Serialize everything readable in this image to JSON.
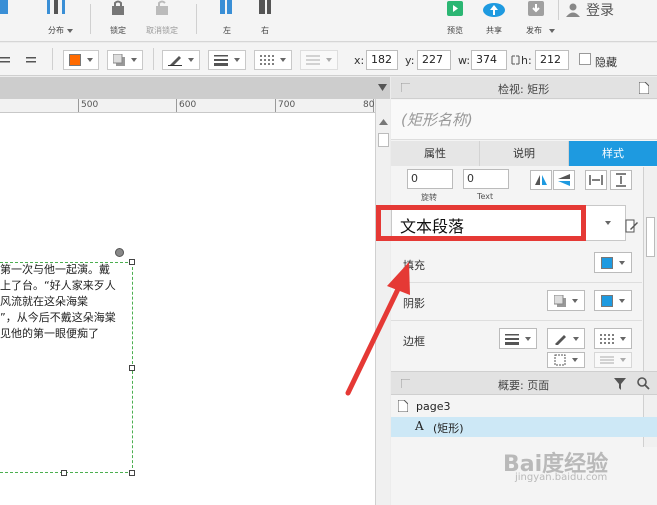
{
  "toolbar": {
    "items": [
      {
        "label": "分布"
      },
      {
        "label": "锁定"
      },
      {
        "label": "取消锁定"
      },
      {
        "label": "左"
      },
      {
        "label": "右"
      },
      {
        "label": "预览"
      },
      {
        "label": "共享"
      },
      {
        "label": "发布"
      }
    ],
    "login_label": "登录"
  },
  "format_bar": {
    "fill_color": "#ff6a00",
    "x_label": "x:",
    "x_value": "182",
    "y_label": "y:",
    "y_value": "227",
    "w_label": "w:",
    "w_value": "374",
    "h_label": "h:",
    "h_value": "212",
    "hidden_label": "隐藏"
  },
  "ruler": {
    "ticks": [
      "500",
      "600",
      "700",
      "80"
    ]
  },
  "canvas": {
    "paragraph_lines": [
      "第一次与他一起演。戴",
      "上了台。“好人家来歹人",
      "风流就在这朵海棠",
      "”，从今后不戴这朵海棠",
      "见他的第一眼便痴了"
    ]
  },
  "inspector": {
    "title": "检视: 矩形",
    "shape_name_placeholder": "(矩形名称)",
    "tabs": [
      "属性",
      "说明",
      "样式"
    ],
    "rotate_value": "0",
    "rotate_label": "旋转",
    "text_rotate_value": "0",
    "text_rotate_label": "Text",
    "style_value": "文本段落",
    "fill_label": "填充",
    "shadow_label": "阴影",
    "border_label": "边框",
    "fill_color": "#1e9ae0",
    "shadow_color": "#1e9ae0"
  },
  "outline": {
    "title": "概要: 页面",
    "page": "page3",
    "item_glyph": "A",
    "item": "(矩形)"
  },
  "watermark": {
    "text": "Bai度经验",
    "sub": "jingyan.baidu.com"
  },
  "colors": {
    "accent": "#1e9ae0",
    "annotation": "#e53935",
    "selection": "#4caf50"
  }
}
